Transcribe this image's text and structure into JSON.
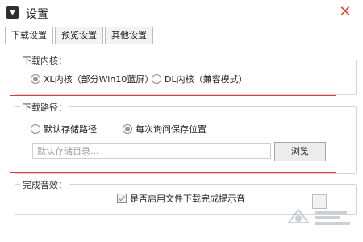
{
  "window": {
    "title": "设置",
    "close_glyph": "✕"
  },
  "tabs": [
    {
      "label": "下载设置",
      "active": true
    },
    {
      "label": "预览设置",
      "active": false
    },
    {
      "label": "其他设置",
      "active": false
    }
  ],
  "kernel": {
    "title": "下载内核：",
    "options": [
      {
        "label": "XL内核（部分Win10蓝屏）",
        "selected": true
      },
      {
        "label": "DL内核（兼容模式）",
        "selected": false
      }
    ]
  },
  "path": {
    "title": "下载路径：",
    "options": [
      {
        "label": "默认存储路径",
        "selected": false
      },
      {
        "label": "每次询问保存位置",
        "selected": true
      }
    ],
    "input_placeholder": "默认存储目录...",
    "browse_label": "浏览"
  },
  "sound": {
    "title": "完成音效：",
    "checkbox_label": "是否启用文件下载完成提示音",
    "checked": true
  },
  "colors": {
    "highlight": "#e53935",
    "close": "#e04a39"
  },
  "icons": {
    "app": "download-app-icon",
    "close": "close-icon",
    "watermark": "system-home-watermark"
  }
}
